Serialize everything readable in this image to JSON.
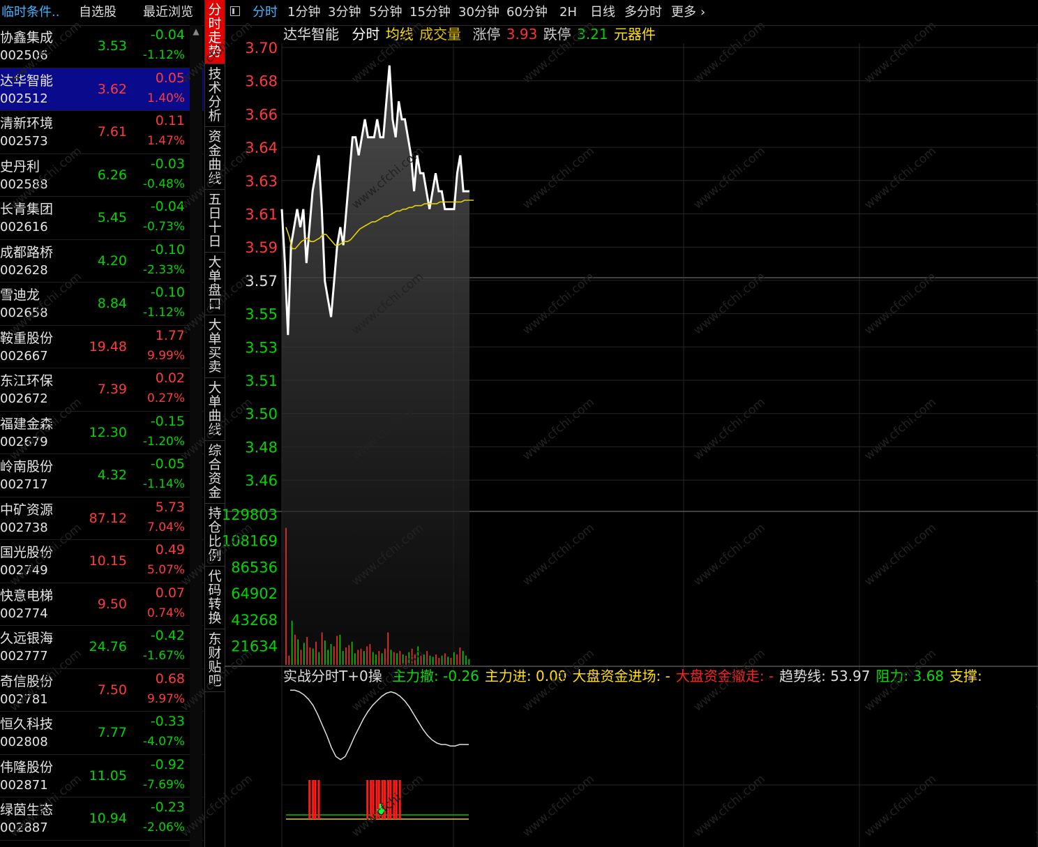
{
  "left_tabs": [
    "临时条件..",
    "自选股",
    "最近浏览"
  ],
  "stocks": [
    {
      "name": "协鑫集成",
      "code": "002506",
      "price": "3.53",
      "change": "-0.04",
      "pct": "-1.12%",
      "dir": "dn"
    },
    {
      "name": "达华智能",
      "code": "002512",
      "price": "3.62",
      "change": "0.05",
      "pct": "1.40%",
      "dir": "up",
      "selected": true
    },
    {
      "name": "清新环境",
      "code": "002573",
      "price": "7.61",
      "change": "0.11",
      "pct": "1.47%",
      "dir": "up"
    },
    {
      "name": "史丹利",
      "code": "002588",
      "price": "6.26",
      "change": "-0.03",
      "pct": "-0.48%",
      "dir": "dn"
    },
    {
      "name": "长青集团",
      "code": "002616",
      "price": "5.45",
      "change": "-0.04",
      "pct": "-0.73%",
      "dir": "dn"
    },
    {
      "name": "成都路桥",
      "code": "002628",
      "price": "4.20",
      "change": "-0.10",
      "pct": "-2.33%",
      "dir": "dn"
    },
    {
      "name": "雪迪龙",
      "code": "002658",
      "price": "8.84",
      "change": "-0.10",
      "pct": "-1.12%",
      "dir": "dn"
    },
    {
      "name": "鞍重股份",
      "code": "002667",
      "price": "19.48",
      "change": "1.77",
      "pct": "9.99%",
      "dir": "up"
    },
    {
      "name": "东江环保",
      "code": "002672",
      "price": "7.39",
      "change": "0.02",
      "pct": "0.27%",
      "dir": "up"
    },
    {
      "name": "福建金森",
      "code": "002679",
      "price": "12.30",
      "change": "-0.15",
      "pct": "-1.20%",
      "dir": "dn"
    },
    {
      "name": "岭南股份",
      "code": "002717",
      "price": "4.32",
      "change": "-0.05",
      "pct": "-1.14%",
      "dir": "dn"
    },
    {
      "name": "中矿资源",
      "code": "002738",
      "price": "87.12",
      "change": "5.73",
      "pct": "7.04%",
      "dir": "up"
    },
    {
      "name": "国光股份",
      "code": "002749",
      "price": "10.15",
      "change": "0.49",
      "pct": "5.07%",
      "dir": "up"
    },
    {
      "name": "快意电梯",
      "code": "002774",
      "price": "9.50",
      "change": "0.07",
      "pct": "0.74%",
      "dir": "up"
    },
    {
      "name": "久远银海",
      "code": "002777",
      "price": "24.76",
      "change": "-0.42",
      "pct": "-1.67%",
      "dir": "dn"
    },
    {
      "name": "奇信股份",
      "code": "002781",
      "price": "7.50",
      "change": "0.68",
      "pct": "9.97%",
      "dir": "up"
    },
    {
      "name": "恒久科技",
      "code": "002808",
      "price": "7.77",
      "change": "-0.33",
      "pct": "-4.07%",
      "dir": "dn"
    },
    {
      "name": "伟隆股份",
      "code": "002871",
      "price": "11.05",
      "change": "-0.92",
      "pct": "-7.69%",
      "dir": "dn"
    },
    {
      "name": "绿茵生态",
      "code": "002887",
      "price": "10.94",
      "change": "-0.23",
      "pct": "-2.06%",
      "dir": "dn"
    }
  ],
  "vertical_tabs": [
    "分时走势",
    "技术分析",
    "资金曲线",
    "五日十日",
    "大单盘口",
    "大单买卖",
    "大单曲线",
    "综合资金",
    "持仓比例",
    "代码转换",
    "东财贴吧"
  ],
  "periods": [
    "分时",
    "1分钟",
    "3分钟",
    "5分钟",
    "15分钟",
    "30分钟",
    "60分钟",
    "2H",
    "日线",
    "多分时",
    "更多"
  ],
  "header": {
    "stock_name": "达华智能",
    "mode": "分时",
    "avg_label": "均线",
    "vol_label": "成交量",
    "limit_up_label": "涨停",
    "limit_up": "3.93",
    "limit_down_label": "跌停",
    "limit_down": "3.21",
    "sector": "元器件"
  },
  "indicator": {
    "name": "实战分时T+0操",
    "items": [
      {
        "text": "主力撤: -0.26",
        "color": "#00e000"
      },
      {
        "text": "主力进: 0.00",
        "color": "#ffe000"
      },
      {
        "text": "大盘资金进场: -",
        "color": "#ffe000"
      },
      {
        "text": "大盘资金撤走: -",
        "color": "#ff2020"
      },
      {
        "text": "趋势线: 53.97",
        "color": "#dddddd"
      },
      {
        "text": "阻力: 3.68",
        "color": "#00e000"
      },
      {
        "text": "支撑:",
        "color": "#ffe000"
      }
    ]
  },
  "colors": {
    "up": "#ff3a3a",
    "down": "#00d400",
    "price_line": "#ffffff",
    "avg_line": "#e6d200",
    "grid": "#2a2a2a"
  },
  "chart_data": {
    "type": "line",
    "price_axis_ticks": [
      "3.70",
      "3.68",
      "3.66",
      "3.64",
      "3.63",
      "3.61",
      "3.59",
      "3.57",
      "3.55",
      "3.53",
      "3.51",
      "3.50",
      "3.48",
      "3.46"
    ],
    "prev_close": 3.57,
    "ylim": [
      3.45,
      3.71
    ],
    "series": [
      {
        "name": "分时",
        "values": [
          3.61,
          3.58,
          3.54,
          3.59,
          3.6,
          3.61,
          3.6,
          3.61,
          3.58,
          3.6,
          3.62,
          3.63,
          3.64,
          3.61,
          3.57,
          3.56,
          3.55,
          3.57,
          3.59,
          3.6,
          3.59,
          3.61,
          3.63,
          3.65,
          3.65,
          3.64,
          3.65,
          3.66,
          3.65,
          3.65,
          3.65,
          3.66,
          3.65,
          3.65,
          3.67,
          3.69,
          3.66,
          3.65,
          3.67,
          3.66,
          3.66,
          3.65,
          3.64,
          3.62,
          3.64,
          3.63,
          3.63,
          3.62,
          3.61,
          3.62,
          3.63,
          3.62,
          3.62,
          3.61,
          3.61,
          3.61,
          3.61,
          3.63,
          3.64,
          3.62,
          3.62,
          3.62
        ]
      },
      {
        "name": "均线",
        "values": [
          3.6,
          3.595,
          3.588,
          3.588,
          3.59,
          3.592,
          3.593,
          3.594,
          3.592,
          3.592,
          3.593,
          3.594,
          3.596,
          3.596,
          3.594,
          3.592,
          3.59,
          3.59,
          3.591,
          3.592,
          3.592,
          3.593,
          3.595,
          3.597,
          3.599,
          3.6,
          3.601,
          3.602,
          3.603,
          3.603,
          3.604,
          3.605,
          3.606,
          3.606,
          3.607,
          3.608,
          3.609,
          3.609,
          3.61,
          3.61,
          3.611,
          3.611,
          3.612,
          3.612,
          3.612,
          3.613,
          3.613,
          3.613,
          3.613,
          3.613,
          3.614,
          3.614,
          3.614,
          3.614,
          3.614,
          3.614,
          3.614,
          3.614,
          3.615,
          3.615,
          3.615,
          3.615
        ]
      }
    ],
    "volume_axis_ticks": [
      "129803",
      "108169",
      "86536",
      "64902",
      "43268",
      "21634"
    ],
    "volume_max": 129803,
    "volume": [
      118000,
      8000,
      38000,
      26000,
      22000,
      13000,
      19000,
      24000,
      15000,
      14000,
      20000,
      11000,
      28000,
      21000,
      13000,
      18000,
      16000,
      25000,
      26000,
      12000,
      15000,
      17000,
      20000,
      10000,
      13000,
      14000,
      12000,
      16000,
      18000,
      11000,
      9000,
      12000,
      10000,
      14000,
      28000,
      13000,
      11000,
      10000,
      12000,
      9000,
      8000,
      11000,
      14000,
      9000,
      16000,
      8000,
      9000,
      12000,
      8000,
      7000,
      9000,
      6000,
      8000,
      10000,
      7000,
      6000,
      11000,
      9000,
      15000,
      12000,
      8000,
      5000
    ],
    "volume_dir": [
      "up",
      "up",
      "dn",
      "up",
      "dn",
      "up",
      "dn",
      "up",
      "up",
      "dn",
      "up",
      "dn",
      "up",
      "dn",
      "dn",
      "dn",
      "up",
      "up",
      "dn",
      "dn",
      "up",
      "up",
      "dn",
      "dn",
      "up",
      "up",
      "dn",
      "up",
      "up",
      "dn",
      "dn",
      "up",
      "dn",
      "up",
      "up",
      "dn",
      "up",
      "dn",
      "up",
      "dn",
      "up",
      "dn",
      "up",
      "up",
      "dn",
      "up",
      "dn",
      "up",
      "dn",
      "dn",
      "up",
      "up",
      "dn",
      "up",
      "dn",
      "up",
      "dn",
      "up",
      "up",
      "dn",
      "dn",
      "dn"
    ],
    "indicator_curve": [
      88,
      88,
      87,
      85,
      82,
      78,
      72,
      65,
      58,
      50,
      44,
      42,
      44,
      50,
      57,
      63,
      69,
      74,
      78,
      81,
      84,
      86,
      87,
      86,
      84,
      81,
      77,
      72,
      67,
      62,
      58,
      55,
      53,
      52,
      52,
      51,
      51,
      52,
      52,
      52
    ],
    "signal_bar_positions": [
      4,
      5,
      14,
      15,
      16,
      17,
      18,
      19
    ],
    "signal_arrow_position": 16
  }
}
